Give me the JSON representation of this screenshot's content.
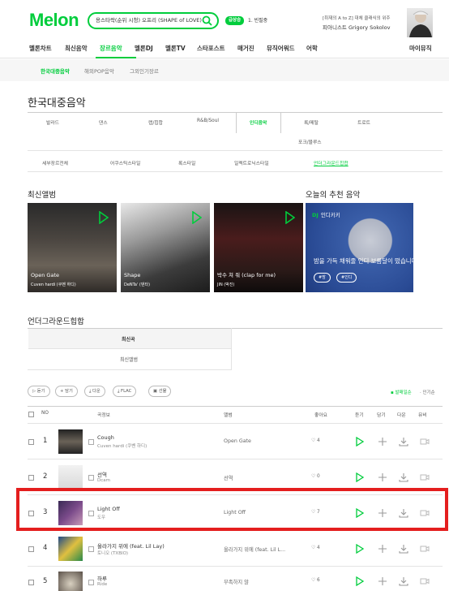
{
  "header": {
    "logo": "Melon",
    "search_value": "용스타락(순위 시청) 오프리 (SHAPE of LOVE)",
    "rank_badge": "급상승",
    "rank_text": "1. 빈필중",
    "promo_subtitle": "[취재의 A to Z] 대체 클래식의 위주",
    "promo_title": "피아니스트 Grigory Sokolov"
  },
  "gnb": [
    "멜론차트",
    "최신음악",
    "장르음악",
    "멜론DJ",
    "멜론TV",
    "스타포스트",
    "매거진",
    "뮤직어워드",
    "어학",
    "마이뮤직"
  ],
  "subnav": [
    "한국대중음악",
    "해외POP음악",
    "그외인기장르"
  ],
  "page_title": "한국대중음악",
  "genres_row1": [
    "발라드",
    "댄스",
    "랩/힙합",
    "R&B/Soul",
    "인디음악",
    "록/메탈",
    "트로트"
  ],
  "genres_row2": [
    "포크/블루스"
  ],
  "subgenres": [
    "세부장르전체",
    "어쿠스틱스타일",
    "록스타일",
    "일렉트로닉스타일",
    "언더그라운드힙합"
  ],
  "latest_title": "최신앨범",
  "albums": [
    {
      "title": "Open Gate",
      "artist": "Cuven hardi (쿠벤 하디)"
    },
    {
      "title": "Shape",
      "artist": "DeNTa' (덴타)"
    },
    {
      "title": "박수 쳐 줘 (clap for me)",
      "artist": "JIN (박진)"
    }
  ],
  "today_title": "오늘의 추천 음악",
  "dj": {
    "badge": "DJ",
    "label": "인디키키",
    "text": "밤을 가득 채워줄 인디 보름달이 떴습니다",
    "tags": [
      "#밤",
      "#인디"
    ]
  },
  "underground_title": "언더그라운드힙합",
  "ut_tabs": [
    "최신곡",
    "최신앨범"
  ],
  "buttons": [
    "듣기",
    "담기",
    "다운",
    "FLAC",
    "선물"
  ],
  "sort": {
    "active": "발매일순",
    "other": "인기순"
  },
  "columns": {
    "no": "NO",
    "song": "곡정보",
    "album": "앨범",
    "like": "좋아요",
    "listen": "듣기",
    "add": "담기",
    "down": "다운",
    "mv": "뮤비"
  },
  "songs": [
    {
      "rank": "1",
      "title": "Cough",
      "artist": "Cuven hardi (쿠벤 하디)",
      "album": "Open Gate",
      "likes": "4"
    },
    {
      "rank": "2",
      "title": "선역",
      "artist": "Dcam",
      "album": "선역",
      "likes": "0"
    },
    {
      "rank": "3",
      "title": "Light Off",
      "artist": "도우",
      "album": "Light Off",
      "likes": "7"
    },
    {
      "rank": "4",
      "title": "올라가지 위에 (feat. Lil Lay)",
      "artist": "토니오 (TXBIO)",
      "album": "올라가지 위에 (feat. Lil L...",
      "likes": "4"
    },
    {
      "rank": "5",
      "title": "하루",
      "artist": "Ride",
      "album": "부족하지 않",
      "likes": "6"
    }
  ],
  "colors": {
    "accent": "#00cd3c",
    "highlight": "#e41e1e"
  }
}
